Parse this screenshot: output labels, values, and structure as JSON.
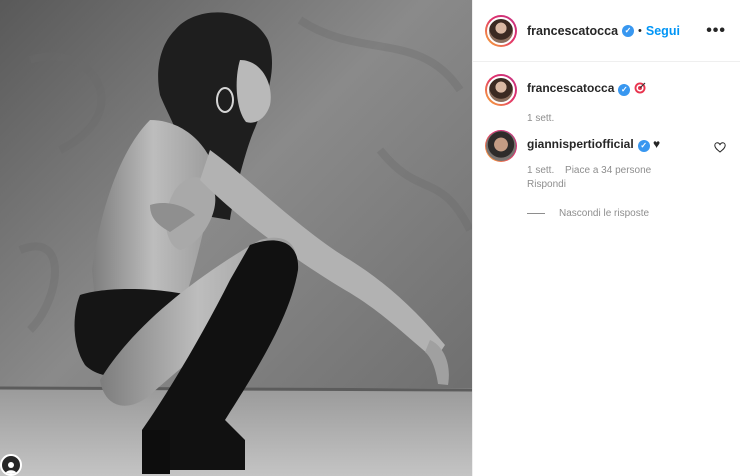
{
  "post": {
    "author": "francescatocca",
    "separator": "•",
    "follow_label": "Segui",
    "more_label": "•••"
  },
  "caption": {
    "author": "francescatocca",
    "emoji": "target-emoji",
    "time": "1 sett."
  },
  "comments": [
    {
      "author": "giannispertiofficial",
      "text": "♥",
      "time": "1 sett.",
      "likes": "Piace a 34 persone",
      "reply_label": "Rispondi"
    }
  ],
  "hide_replies_label": "Nascondi le risposte",
  "colors": {
    "accent": "#0095f6",
    "verified": "#3897f0",
    "muted": "#8e8e8e"
  },
  "icons": [
    "verified-badge-icon",
    "more-options-icon",
    "heart-icon",
    "profile-icon"
  ]
}
